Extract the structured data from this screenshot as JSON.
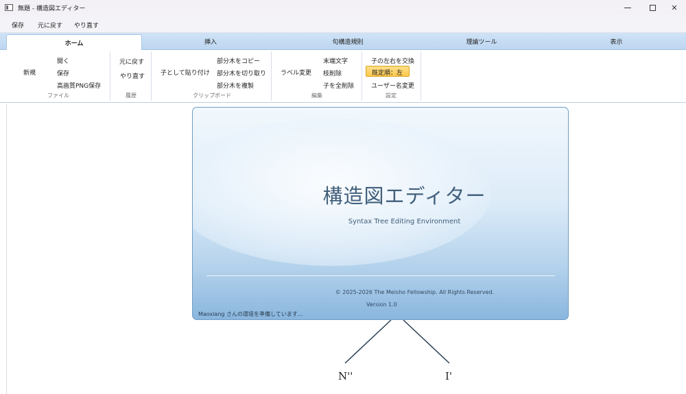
{
  "window": {
    "title": "無題 - 構造図エディター",
    "controls": {
      "minimize": "",
      "maximize": "",
      "close": "✕"
    }
  },
  "quick_access": {
    "save": "保存",
    "undo": "元に戻す",
    "redo": "やり直す"
  },
  "tabs": [
    "ホーム",
    "挿入",
    "句構造規則",
    "理論ツール",
    "表示"
  ],
  "ribbon": {
    "file": {
      "new": "新規",
      "open": "開く",
      "save": "保存",
      "save_png": "高画質PNG保存",
      "label": "ファイル"
    },
    "history": {
      "undo": "元に戻す",
      "redo": "やり直す",
      "label": "履歴"
    },
    "clipboard": {
      "paste_as_child": "子として貼り付け",
      "copy_subtree": "部分木をコピー",
      "cut_subtree": "部分木を切り取り",
      "duplicate_subtree": "部分木を複製",
      "label": "クリップボード"
    },
    "edit": {
      "relabel": "ラベル変更",
      "terminal": "末端文字",
      "delete_branch": "枝削除",
      "delete_all_children": "子を全削除",
      "label": "編集"
    },
    "settings": {
      "swap_children": "子の左右を交換",
      "default_order": "既定順：左",
      "change_username": "ユーザー名変更",
      "label": "設定"
    }
  },
  "splash": {
    "title": "構造図エディター",
    "subtitle": "Syntax Tree Editing Environment",
    "copyright": "© 2025-2026 The Meisho Fellowship. All Rights Reserved.",
    "version": "Version 1.0",
    "status": "Maoxiang さんの環境を準備しています..."
  },
  "tree": {
    "nodes": [
      "N''",
      "I'"
    ]
  },
  "colors": {
    "tab_bar": "#cfe3f6",
    "splash_border": "#6e9cc4",
    "highlight_button": "#ffc94d",
    "splash_title": "#41607c"
  }
}
